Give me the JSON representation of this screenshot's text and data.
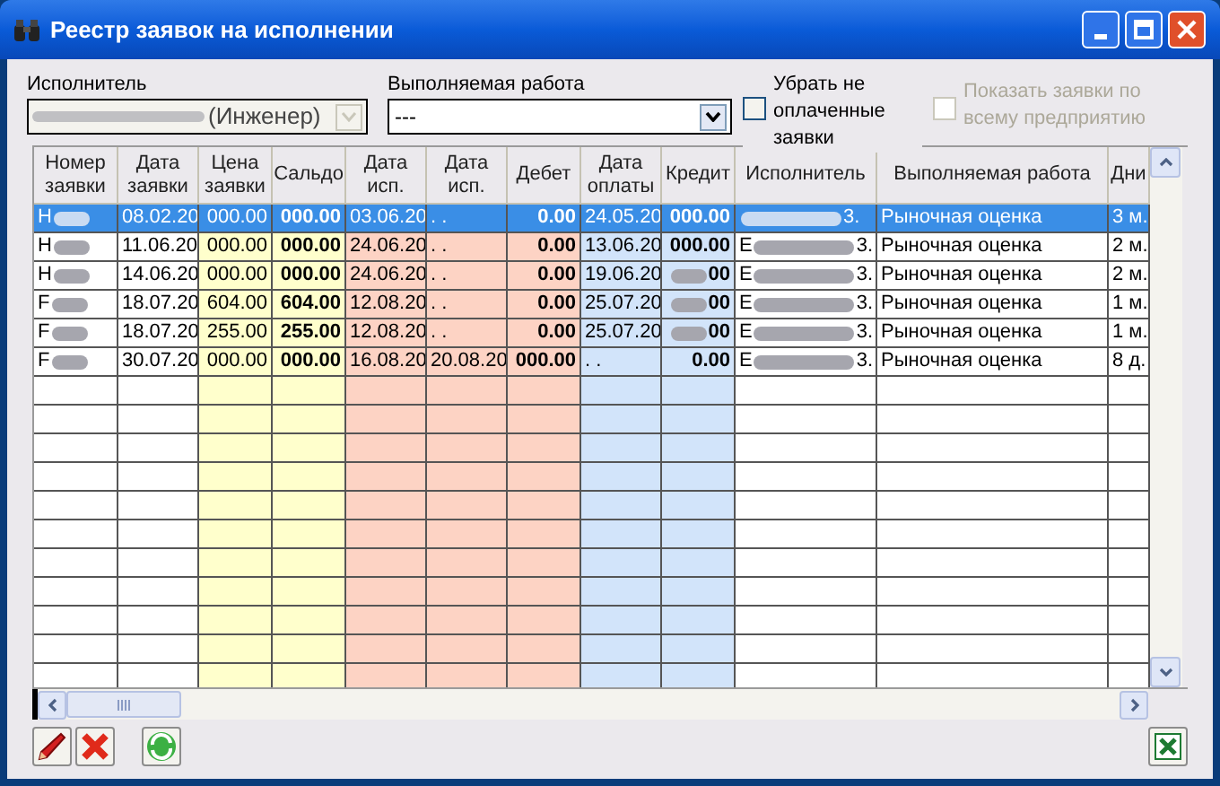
{
  "window": {
    "title": "Реестр заявок на исполнении"
  },
  "filters": {
    "executor": {
      "label": "Исполнитель",
      "value_suffix": "(Инженер)",
      "disabled": true
    },
    "work": {
      "label": "Выполняемая работа",
      "value": "---"
    },
    "checkboxes": [
      {
        "label": "Убрать не оплаченные заявки",
        "checked": false,
        "disabled": false
      },
      {
        "label": "Показать заявки по всему предприятию",
        "checked": false,
        "disabled": true
      }
    ]
  },
  "table": {
    "columns": [
      {
        "label": "Номер заявки",
        "color": "#ffffff"
      },
      {
        "label": "Дата заявки",
        "color": "#ffffff"
      },
      {
        "label": "Цена заявки",
        "color": "#ffffcc"
      },
      {
        "label": "Сальдо",
        "color": "#ffffcc"
      },
      {
        "label": "Дата исп.",
        "color": "#fdd3c4"
      },
      {
        "label": "Дата исп.",
        "color": "#fdd3c4"
      },
      {
        "label": "Дебет",
        "color": "#fdd3c4"
      },
      {
        "label": "Дата оплаты",
        "color": "#d2e4fa"
      },
      {
        "label": "Кредит",
        "color": "#d2e4fa"
      },
      {
        "label": "Исполнитель",
        "color": "#ffffff"
      },
      {
        "label": "Выполняемая работа",
        "color": "#ffffff"
      },
      {
        "label": "Дни",
        "color": "#ffffff"
      }
    ],
    "rows": [
      {
        "selected": true,
        "cells": [
          {
            "kind": "blurred",
            "prefix": "H"
          },
          "08.02.20",
          "000.00",
          "000.00",
          "03.06.20",
          ". .",
          "0.00",
          "24.05.20",
          "000.00",
          {
            "kind": "blurred",
            "suffix": "3."
          },
          "Рыночная оценка",
          "3 м."
        ]
      },
      {
        "selected": false,
        "cells": [
          {
            "kind": "blurred",
            "prefix": "H"
          },
          "11.06.20",
          "000.00",
          "000.00",
          "24.06.20",
          ". .",
          "0.00",
          "13.06.20",
          "000.00",
          {
            "kind": "blurred",
            "prefix": "E",
            "suffix": "3."
          },
          "Рыночная оценка",
          "2 м."
        ]
      },
      {
        "selected": false,
        "cells": [
          {
            "kind": "blurred",
            "prefix": "H"
          },
          "14.06.20",
          "000.00",
          "000.00",
          "24.06.20",
          ". .",
          "0.00",
          "19.06.20",
          {
            "kind": "blurred",
            "suffix": "00"
          },
          {
            "kind": "blurred",
            "prefix": "E",
            "suffix": "3."
          },
          "Рыночная оценка",
          "2 м."
        ]
      },
      {
        "selected": false,
        "cells": [
          {
            "kind": "blurred",
            "prefix": "F"
          },
          "18.07.20",
          "604.00",
          "604.00",
          "12.08.20",
          ". .",
          "0.00",
          "25.07.20",
          {
            "kind": "blurred",
            "suffix": "00"
          },
          {
            "kind": "blurred",
            "prefix": "E",
            "suffix": "3."
          },
          "Рыночная оценка",
          "1 м."
        ]
      },
      {
        "selected": false,
        "cells": [
          {
            "kind": "blurred",
            "prefix": "F"
          },
          "18.07.20",
          "255.00",
          "255.00",
          "12.08.20",
          ". .",
          "0.00",
          "25.07.20",
          {
            "kind": "blurred",
            "suffix": "00"
          },
          {
            "kind": "blurred",
            "prefix": "E",
            "suffix": "3."
          },
          "Рыночная оценка",
          "1 м."
        ]
      },
      {
        "selected": false,
        "cells": [
          {
            "kind": "blurred",
            "prefix": "F"
          },
          "30.07.20",
          "000.00",
          "000.00",
          "16.08.20",
          "20.08.20",
          "000.00",
          ". .",
          "0.00",
          {
            "kind": "blurred",
            "prefix": "E",
            "suffix": "3."
          },
          "Рыночная оценка",
          "8 д."
        ]
      }
    ]
  },
  "toolbar": [
    {
      "kind": "edit"
    },
    {
      "kind": "delete"
    },
    {
      "kind": "refresh"
    },
    {
      "kind": "excel"
    }
  ]
}
